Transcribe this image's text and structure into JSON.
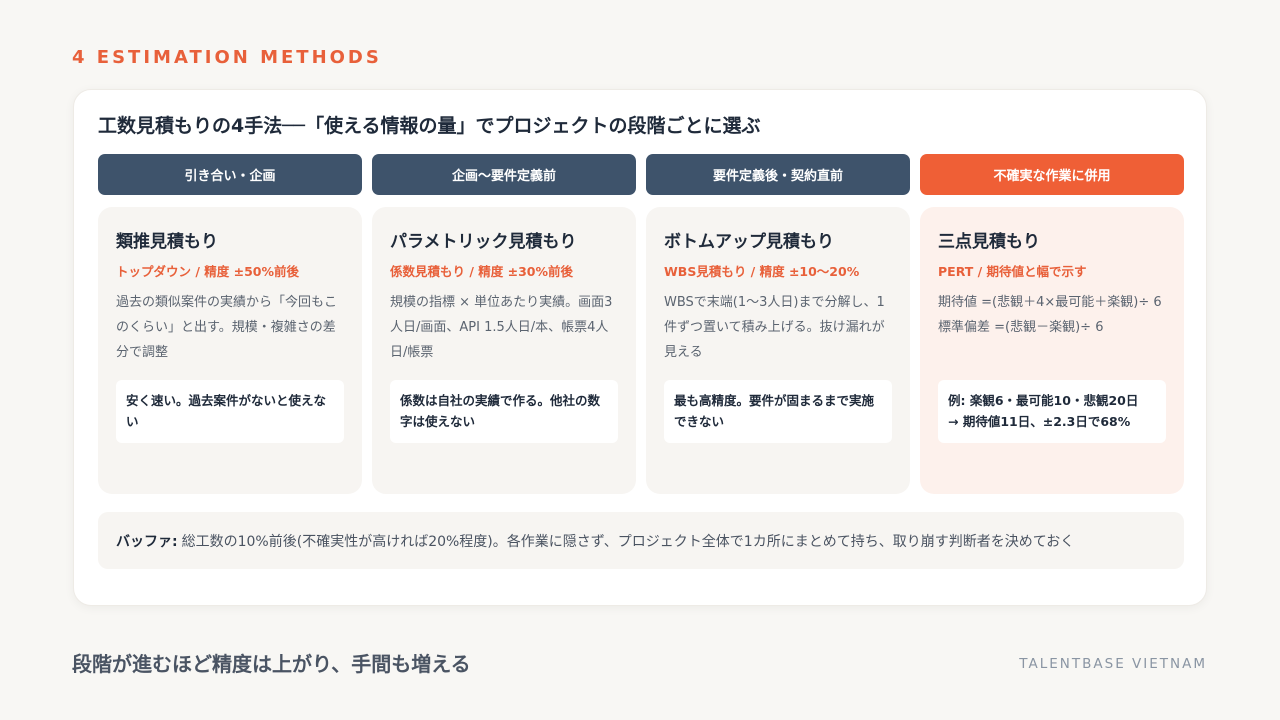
{
  "eyebrow": "4 ESTIMATION METHODS",
  "title": "工数見積もりの4手法──「使える情報の量」でプロジェクトの段階ごとに選ぶ",
  "stages": [
    "引き合い・企画",
    "企画〜要件定義前",
    "要件定義後・契約直前",
    "不確実な作業に併用"
  ],
  "methods": [
    {
      "name": "類推見積もり",
      "sub": "トップダウン / 精度 ±50%前後",
      "desc": "過去の類似案件の実績から「今回もこのくらい」と出す。規模・複雑さの差分で調整",
      "note": "安く速い。過去案件がないと使えない"
    },
    {
      "name": "パラメトリック見積もり",
      "sub": "係数見積もり / 精度 ±30%前後",
      "desc": "規模の指標 × 単位あたり実績。画面3人日/画面、API 1.5人日/本、帳票4人日/帳票",
      "note": "係数は自社の実績で作る。他社の数字は使えない"
    },
    {
      "name": "ボトムアップ見積もり",
      "sub": "WBS見積もり / 精度 ±10〜20%",
      "desc": "WBSで末端(1〜3人日)まで分解し、1件ずつ置いて積み上げる。抜け漏れが見える",
      "note": "最も高精度。要件が固まるまで実施できない"
    },
    {
      "name": "三点見積もり",
      "sub": "PERT / 期待値と幅で示す",
      "desc_line1": "期待値 =(悲観＋4×最可能＋楽観)÷ 6",
      "desc_line2": "標準偏差 =(悲観－楽観)÷ 6",
      "note_line1": "例: 楽観6・最可能10・悲観20日",
      "note_line2": "→ 期待値11日、±2.3日で68%"
    }
  ],
  "buffer": {
    "label": "バッファ:",
    "text": "総工数の10%前後(不確実性が高ければ20%程度)。各作業に隠さず、プロジェクト全体で1カ所にまとめて持ち、取り崩す判断者を決めておく"
  },
  "footer": "段階が進むほど精度は上がり、手間も増える",
  "brand": "TALENTBASE VIETNAM",
  "colors": {
    "accent": "#ef5f36",
    "stage_bg": "#3e536b"
  }
}
